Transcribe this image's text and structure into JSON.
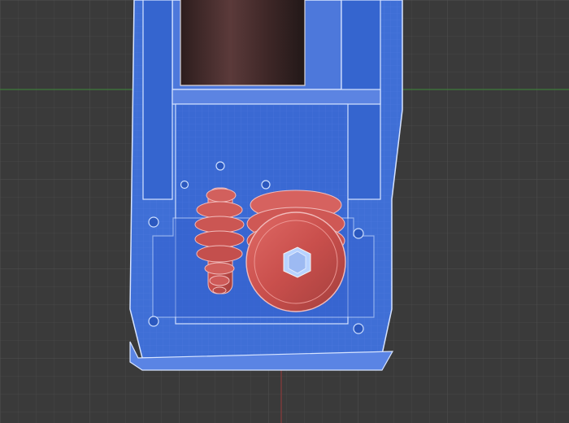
{
  "viewport": {
    "background": "#3a3a3a",
    "grid_minor_color": "#474747",
    "grid_major_color": "#505050",
    "x_axis_color": "#3f7a3a",
    "y_axis_color": "#8a3b3b"
  },
  "model": {
    "housing_color": "#3f6fd6",
    "housing_edge_color": "#d7e4ff",
    "housing_shadow_color": "#2d58bb",
    "housing_highlight_color": "#5784e6",
    "gear_color": "#c94f4c",
    "gear_shadow_color": "#9e3d3b",
    "bore_color": "#4b2a2a",
    "hex_socket_color": "#b8d3ff"
  },
  "icons": {
    "hex_socket": "hex-socket-icon"
  }
}
